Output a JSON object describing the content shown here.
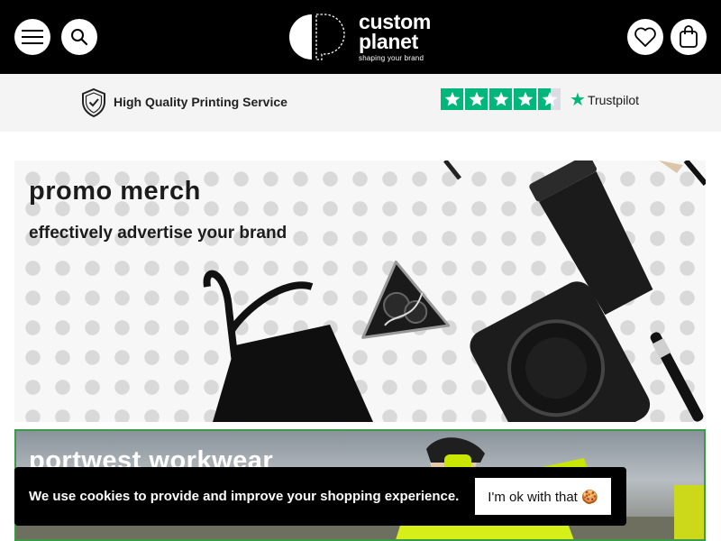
{
  "header": {
    "menu_icon": "hamburger-menu-icon",
    "search_icon": "search-icon",
    "wishlist_icon": "heart-icon",
    "bag_icon": "shopping-bag-icon",
    "logo": {
      "line1": "custom",
      "line2": "planet",
      "tagline": "shaping your brand"
    }
  },
  "trust_bar": {
    "shield_icon": "shield-check-icon",
    "quality_text": "High Quality Printing Service",
    "rating_stars": 4.5,
    "trustpilot_label": "Trustpilot",
    "colors": {
      "trustpilot_green": "#00b67a"
    }
  },
  "promo_banner": {
    "title": "promo merch",
    "subtitle": "effectively advertise your brand"
  },
  "workwear_banner": {
    "title": "portwest workwear"
  },
  "cookie_banner": {
    "message": "We use cookies to provide and improve your shopping experience.",
    "accept_label": "I'm ok with that 🍪"
  }
}
